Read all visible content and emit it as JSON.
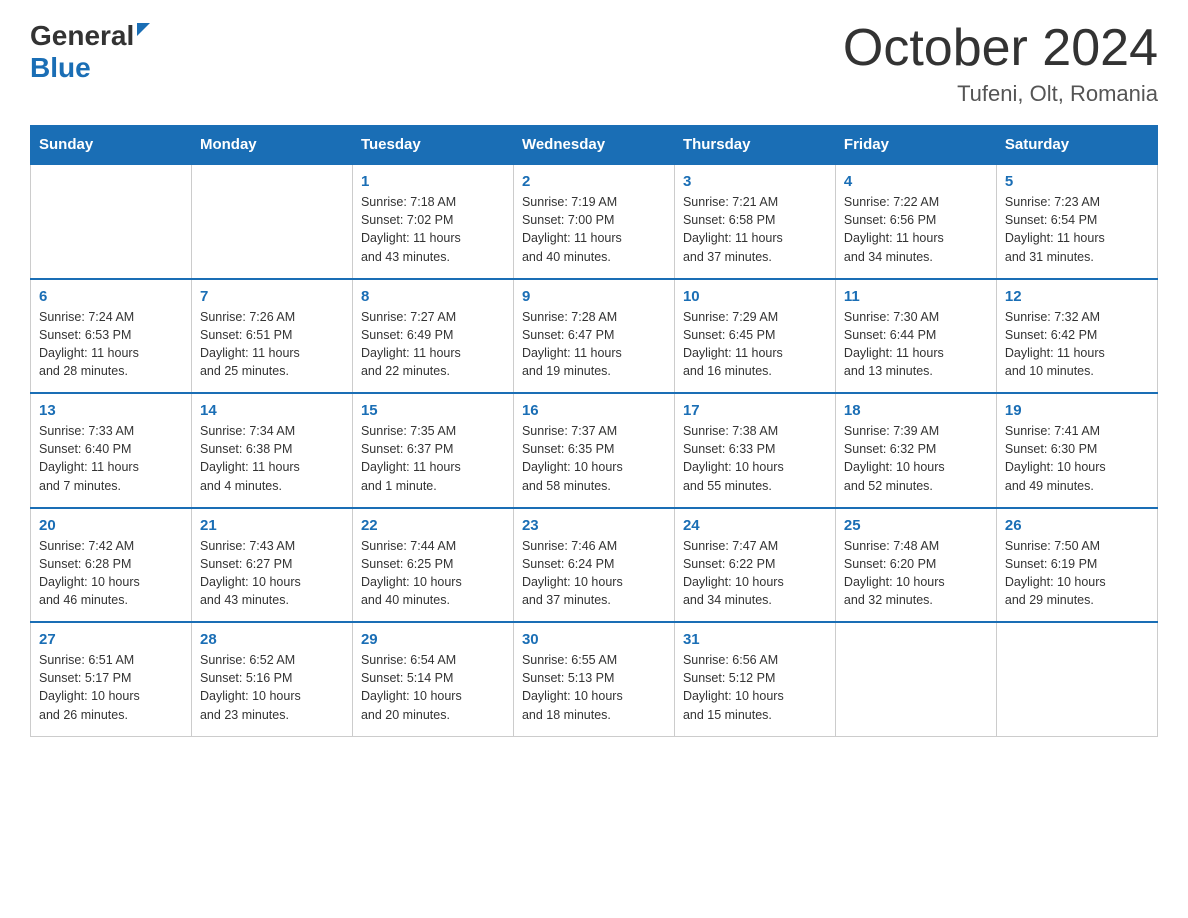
{
  "header": {
    "logo": {
      "general": "General",
      "blue": "Blue",
      "arrow": "▶"
    },
    "title": "October 2024",
    "location": "Tufeni, Olt, Romania"
  },
  "calendar": {
    "weekdays": [
      "Sunday",
      "Monday",
      "Tuesday",
      "Wednesday",
      "Thursday",
      "Friday",
      "Saturday"
    ],
    "weeks": [
      [
        {
          "day": "",
          "info": ""
        },
        {
          "day": "",
          "info": ""
        },
        {
          "day": "1",
          "info": "Sunrise: 7:18 AM\nSunset: 7:02 PM\nDaylight: 11 hours\nand 43 minutes."
        },
        {
          "day": "2",
          "info": "Sunrise: 7:19 AM\nSunset: 7:00 PM\nDaylight: 11 hours\nand 40 minutes."
        },
        {
          "day": "3",
          "info": "Sunrise: 7:21 AM\nSunset: 6:58 PM\nDaylight: 11 hours\nand 37 minutes."
        },
        {
          "day": "4",
          "info": "Sunrise: 7:22 AM\nSunset: 6:56 PM\nDaylight: 11 hours\nand 34 minutes."
        },
        {
          "day": "5",
          "info": "Sunrise: 7:23 AM\nSunset: 6:54 PM\nDaylight: 11 hours\nand 31 minutes."
        }
      ],
      [
        {
          "day": "6",
          "info": "Sunrise: 7:24 AM\nSunset: 6:53 PM\nDaylight: 11 hours\nand 28 minutes."
        },
        {
          "day": "7",
          "info": "Sunrise: 7:26 AM\nSunset: 6:51 PM\nDaylight: 11 hours\nand 25 minutes."
        },
        {
          "day": "8",
          "info": "Sunrise: 7:27 AM\nSunset: 6:49 PM\nDaylight: 11 hours\nand 22 minutes."
        },
        {
          "day": "9",
          "info": "Sunrise: 7:28 AM\nSunset: 6:47 PM\nDaylight: 11 hours\nand 19 minutes."
        },
        {
          "day": "10",
          "info": "Sunrise: 7:29 AM\nSunset: 6:45 PM\nDaylight: 11 hours\nand 16 minutes."
        },
        {
          "day": "11",
          "info": "Sunrise: 7:30 AM\nSunset: 6:44 PM\nDaylight: 11 hours\nand 13 minutes."
        },
        {
          "day": "12",
          "info": "Sunrise: 7:32 AM\nSunset: 6:42 PM\nDaylight: 11 hours\nand 10 minutes."
        }
      ],
      [
        {
          "day": "13",
          "info": "Sunrise: 7:33 AM\nSunset: 6:40 PM\nDaylight: 11 hours\nand 7 minutes."
        },
        {
          "day": "14",
          "info": "Sunrise: 7:34 AM\nSunset: 6:38 PM\nDaylight: 11 hours\nand 4 minutes."
        },
        {
          "day": "15",
          "info": "Sunrise: 7:35 AM\nSunset: 6:37 PM\nDaylight: 11 hours\nand 1 minute."
        },
        {
          "day": "16",
          "info": "Sunrise: 7:37 AM\nSunset: 6:35 PM\nDaylight: 10 hours\nand 58 minutes."
        },
        {
          "day": "17",
          "info": "Sunrise: 7:38 AM\nSunset: 6:33 PM\nDaylight: 10 hours\nand 55 minutes."
        },
        {
          "day": "18",
          "info": "Sunrise: 7:39 AM\nSunset: 6:32 PM\nDaylight: 10 hours\nand 52 minutes."
        },
        {
          "day": "19",
          "info": "Sunrise: 7:41 AM\nSunset: 6:30 PM\nDaylight: 10 hours\nand 49 minutes."
        }
      ],
      [
        {
          "day": "20",
          "info": "Sunrise: 7:42 AM\nSunset: 6:28 PM\nDaylight: 10 hours\nand 46 minutes."
        },
        {
          "day": "21",
          "info": "Sunrise: 7:43 AM\nSunset: 6:27 PM\nDaylight: 10 hours\nand 43 minutes."
        },
        {
          "day": "22",
          "info": "Sunrise: 7:44 AM\nSunset: 6:25 PM\nDaylight: 10 hours\nand 40 minutes."
        },
        {
          "day": "23",
          "info": "Sunrise: 7:46 AM\nSunset: 6:24 PM\nDaylight: 10 hours\nand 37 minutes."
        },
        {
          "day": "24",
          "info": "Sunrise: 7:47 AM\nSunset: 6:22 PM\nDaylight: 10 hours\nand 34 minutes."
        },
        {
          "day": "25",
          "info": "Sunrise: 7:48 AM\nSunset: 6:20 PM\nDaylight: 10 hours\nand 32 minutes."
        },
        {
          "day": "26",
          "info": "Sunrise: 7:50 AM\nSunset: 6:19 PM\nDaylight: 10 hours\nand 29 minutes."
        }
      ],
      [
        {
          "day": "27",
          "info": "Sunrise: 6:51 AM\nSunset: 5:17 PM\nDaylight: 10 hours\nand 26 minutes."
        },
        {
          "day": "28",
          "info": "Sunrise: 6:52 AM\nSunset: 5:16 PM\nDaylight: 10 hours\nand 23 minutes."
        },
        {
          "day": "29",
          "info": "Sunrise: 6:54 AM\nSunset: 5:14 PM\nDaylight: 10 hours\nand 20 minutes."
        },
        {
          "day": "30",
          "info": "Sunrise: 6:55 AM\nSunset: 5:13 PM\nDaylight: 10 hours\nand 18 minutes."
        },
        {
          "day": "31",
          "info": "Sunrise: 6:56 AM\nSunset: 5:12 PM\nDaylight: 10 hours\nand 15 minutes."
        },
        {
          "day": "",
          "info": ""
        },
        {
          "day": "",
          "info": ""
        }
      ]
    ]
  }
}
